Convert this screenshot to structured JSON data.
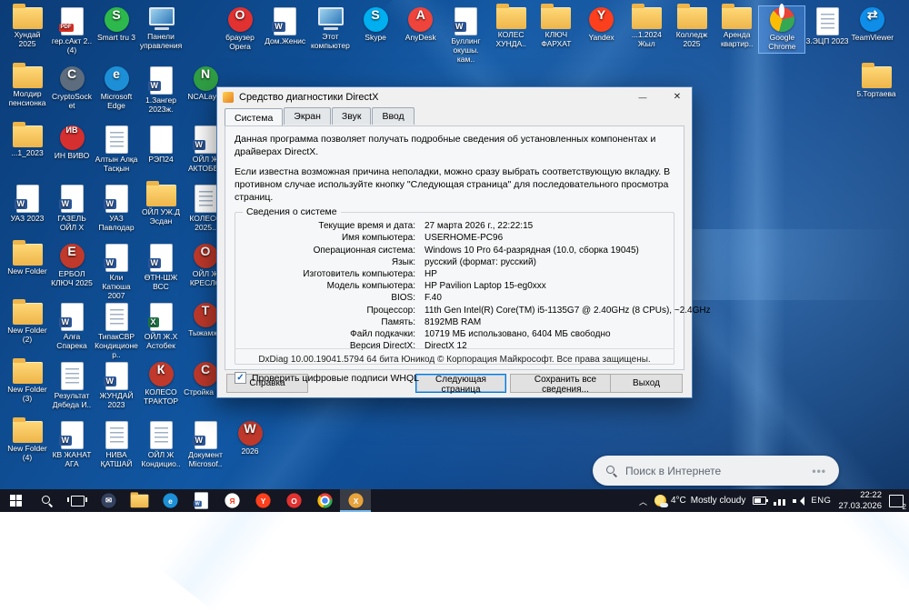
{
  "desktop": {
    "search_pill": {
      "text": "Поиск в Интернете",
      "more": "•••"
    },
    "icons": {
      "left_rows": [
        [
          {
            "label": "Хундай 2025",
            "kind": "folder"
          },
          {
            "label": "гер.сАкт 2.. (4)",
            "kind": "pdf"
          },
          {
            "label": "Smart tru 3",
            "kind": "app",
            "icon": "smart-tru",
            "color": "#2db84c",
            "letter": "S"
          },
          {
            "label": "Панели управления",
            "kind": "computer"
          }
        ],
        [
          {
            "label": "Молдир пенсионка",
            "kind": "folder"
          },
          {
            "label": "CryptoSocket",
            "kind": "app",
            "icon": "cryptosocket",
            "color": "#5d6d7e",
            "letter": "C"
          },
          {
            "label": "Microsoft Edge",
            "kind": "app",
            "icon": "edge",
            "color": "#1d8fd6",
            "letter": "e"
          },
          {
            "label": "1.Зангер 2023ж.",
            "kind": "word"
          },
          {
            "label": "NCALayer",
            "kind": "app",
            "icon": "ncalayer",
            "color": "#2f9e44",
            "letter": "N"
          }
        ],
        [
          {
            "label": "...1_2023",
            "kind": "folder"
          },
          {
            "label": "ИН ВИВО",
            "kind": "app",
            "icon": "invivo",
            "color": "#d62f2f",
            "letter": "ИВ"
          },
          {
            "label": "Алтын Алқа Тасқын",
            "kind": "doc"
          },
          {
            "label": "РЭП24",
            "kind": "page"
          },
          {
            "label": "ОЙЛ Ж АКТОБЕ..",
            "kind": "word"
          }
        ],
        [
          {
            "label": "УАЗ 2023",
            "kind": "word"
          },
          {
            "label": "ГАЗЕЛЬ ОЙЛ X",
            "kind": "word"
          },
          {
            "label": "УАЗ Павлодар",
            "kind": "word"
          },
          {
            "label": "ОЙЛ УЖ.Д Эсдан",
            "kind": "folder"
          },
          {
            "label": "КОЛЕСО 2025..",
            "kind": "doc"
          }
        ],
        [
          {
            "label": "New Folder",
            "kind": "folder"
          },
          {
            "label": "ЕРБОЛ КЛЮЧ 2025",
            "kind": "app",
            "icon": "erbol",
            "color": "#c0392b",
            "letter": "Е"
          },
          {
            "label": "Кли Катюша 2007",
            "kind": "word"
          },
          {
            "label": "ӨТН-ШЖ ВСС",
            "kind": "word"
          },
          {
            "label": "ОЙЛ Ж КРЕСЛО",
            "kind": "app",
            "icon": "kreslo",
            "color": "#c0392b",
            "letter": "О"
          }
        ],
        [
          {
            "label": "New Folder (2)",
            "kind": "folder"
          },
          {
            "label": "Алға Спарека",
            "kind": "word"
          },
          {
            "label": "ТипакСВР Кондиционер..",
            "kind": "doc"
          },
          {
            "label": "ОЙЛ Ж.Х Астобек",
            "kind": "excel"
          },
          {
            "label": "Тыжамже",
            "kind": "app",
            "icon": "doc-red",
            "color": "#c0392b",
            "letter": "Т"
          }
        ],
        [
          {
            "label": "New Folder (3)",
            "kind": "folder"
          },
          {
            "label": "Результат Дябеда И..",
            "kind": "doc"
          },
          {
            "label": "ЖУНДАЙ 2023",
            "kind": "word"
          },
          {
            "label": "КОЛЕСО ТРАКТОР",
            "kind": "app",
            "icon": "koleso",
            "color": "#c0392b",
            "letter": "К"
          },
          {
            "label": "Стройка Ш..",
            "kind": "app",
            "icon": "stroyka",
            "color": "#c0392b",
            "letter": "С"
          }
        ],
        [
          {
            "label": "New Folder (4)",
            "kind": "folder"
          },
          {
            "label": "КВ ЖАНАТ АГА",
            "kind": "word"
          },
          {
            "label": "НИВА ҚАТШАЙ",
            "kind": "doc"
          },
          {
            "label": "ОЙЛ Ж Кондицио..",
            "kind": "doc"
          },
          {
            "label": "Документ Microsof..",
            "kind": "word"
          },
          {
            "label": "2026",
            "kind": "app",
            "icon": "doc-2026",
            "color": "#c0392b",
            "letter": "W"
          }
        ]
      ],
      "top_row": [
        {
          "label": "браузер Opera",
          "kind": "app",
          "icon": "opera",
          "color": "#e23131",
          "letter": "O"
        },
        {
          "label": "Дом.Женис",
          "kind": "word"
        },
        {
          "label": "Этот компьютер",
          "kind": "computer"
        },
        {
          "label": "Skype",
          "kind": "app",
          "icon": "skype",
          "color": "#00aff0",
          "letter": "S"
        },
        {
          "label": "AnyDesk",
          "kind": "app",
          "icon": "anydesk",
          "color": "#ef443b",
          "letter": "A"
        },
        {
          "label": "Буллинг окушы. кам..",
          "kind": "word"
        },
        {
          "label": "КОЛЕС ХУНДА..",
          "kind": "folder"
        },
        {
          "label": "КЛЮЧ ФАРХАТ",
          "kind": "folder"
        },
        {
          "label": "Yandex",
          "kind": "app",
          "icon": "yandex",
          "color": "#fc3f1d",
          "letter": "Y"
        },
        {
          "label": "...1.2024 Жыл",
          "kind": "folder"
        },
        {
          "label": "Колледж 2025",
          "kind": "folder"
        },
        {
          "label": "Аренда квартир..",
          "kind": "folder"
        },
        {
          "label": "Google Chrome",
          "kind": "chrome",
          "selected": true
        },
        {
          "label": "3.ЭЦП 2023",
          "kind": "doc"
        },
        {
          "label": "TeamViewer",
          "kind": "app",
          "icon": "teamviewer",
          "color": "#0e8ee9",
          "letter": "⇄"
        }
      ],
      "right_column": [
        {
          "label": "5.Тортаева",
          "kind": "folder"
        }
      ]
    }
  },
  "dxdiag": {
    "title": "Средство диагностики DirectX",
    "tabs": [
      {
        "label": "Система",
        "active": true
      },
      {
        "label": "Экран",
        "active": false
      },
      {
        "label": "Звук",
        "active": false
      },
      {
        "label": "Ввод",
        "active": false
      }
    ],
    "intro1": "Данная программа позволяет получать подробные сведения об установленных компонентах и драйверах DirectX.",
    "intro2": "Если известна возможная причина неполадки, можно сразу выбрать соответствующую вкладку. В противном случае используйте кнопку \"Следующая страница\" для последовательного просмотра страниц.",
    "group_title": "Сведения о системе",
    "fields": [
      {
        "label": "Текущие время и дата:",
        "value": "27 марта 2026 г., 22:22:15"
      },
      {
        "label": "Имя компьютера:",
        "value": "USERHOME-PC96"
      },
      {
        "label": "Операционная система:",
        "value": "Windows 10 Pro 64-разрядная (10.0, сборка 19045)"
      },
      {
        "label": "Язык:",
        "value": "русский (формат: русский)"
      },
      {
        "label": "Изготовитель компьютера:",
        "value": "HP"
      },
      {
        "label": "Модель компьютера:",
        "value": "HP Pavilion Laptop 15-eg0xxx"
      },
      {
        "label": "BIOS:",
        "value": "F.40"
      },
      {
        "label": "Процессор:",
        "value": "11th Gen Intel(R) Core(TM) i5-1135G7 @ 2.40GHz (8 CPUs), ~2.4GHz"
      },
      {
        "label": "Память:",
        "value": "8192MB RAM"
      },
      {
        "label": "Файл подкачки:",
        "value": "10719 МБ использовано, 6404 МБ свободно"
      },
      {
        "label": "Версия DirectX:",
        "value": "DirectX 12"
      }
    ],
    "whql_label": "Проверить цифровые подписи WHQL",
    "whql_checked": true,
    "footer": "DxDiag 10.00.19041.5794 64 бита Юникод © Корпорация Майкрософт. Все права защищены.",
    "buttons": {
      "help": "Справка",
      "next": "Следующая страница",
      "save": "Сохранить все сведения...",
      "exit": "Выход"
    }
  },
  "taskbar": {
    "apps": [
      {
        "name": "mail",
        "kind": "app",
        "icon": "mail",
        "color": "#33415e",
        "letter": "✉"
      },
      {
        "name": "file-explorer",
        "kind": "folder"
      },
      {
        "name": "edge-browser",
        "kind": "app",
        "icon": "edge",
        "color": "#1d8fd6",
        "letter": "e"
      },
      {
        "name": "word",
        "kind": "word"
      },
      {
        "name": "yandex-browser",
        "kind": "app",
        "icon": "yandex-browser",
        "color": "#ffffff",
        "letter": "Я",
        "letterColor": "#fc3f1d"
      },
      {
        "name": "yandex",
        "kind": "app",
        "icon": "yandex",
        "color": "#fc3f1d",
        "letter": "Y"
      },
      {
        "name": "opera-browser",
        "kind": "app",
        "icon": "opera",
        "color": "#e23131",
        "letter": "O"
      },
      {
        "name": "chrome-browser",
        "kind": "chrome"
      },
      {
        "name": "dxdiag",
        "kind": "app",
        "icon": "dxdiag",
        "color": "#e8a33d",
        "letter": "X",
        "active": true
      }
    ],
    "tray": {
      "weather_temp": "4°C",
      "weather_text": "Mostly cloudy",
      "language": "ENG",
      "time": "22:22",
      "date": "27.03.2026",
      "badge": "2"
    }
  }
}
